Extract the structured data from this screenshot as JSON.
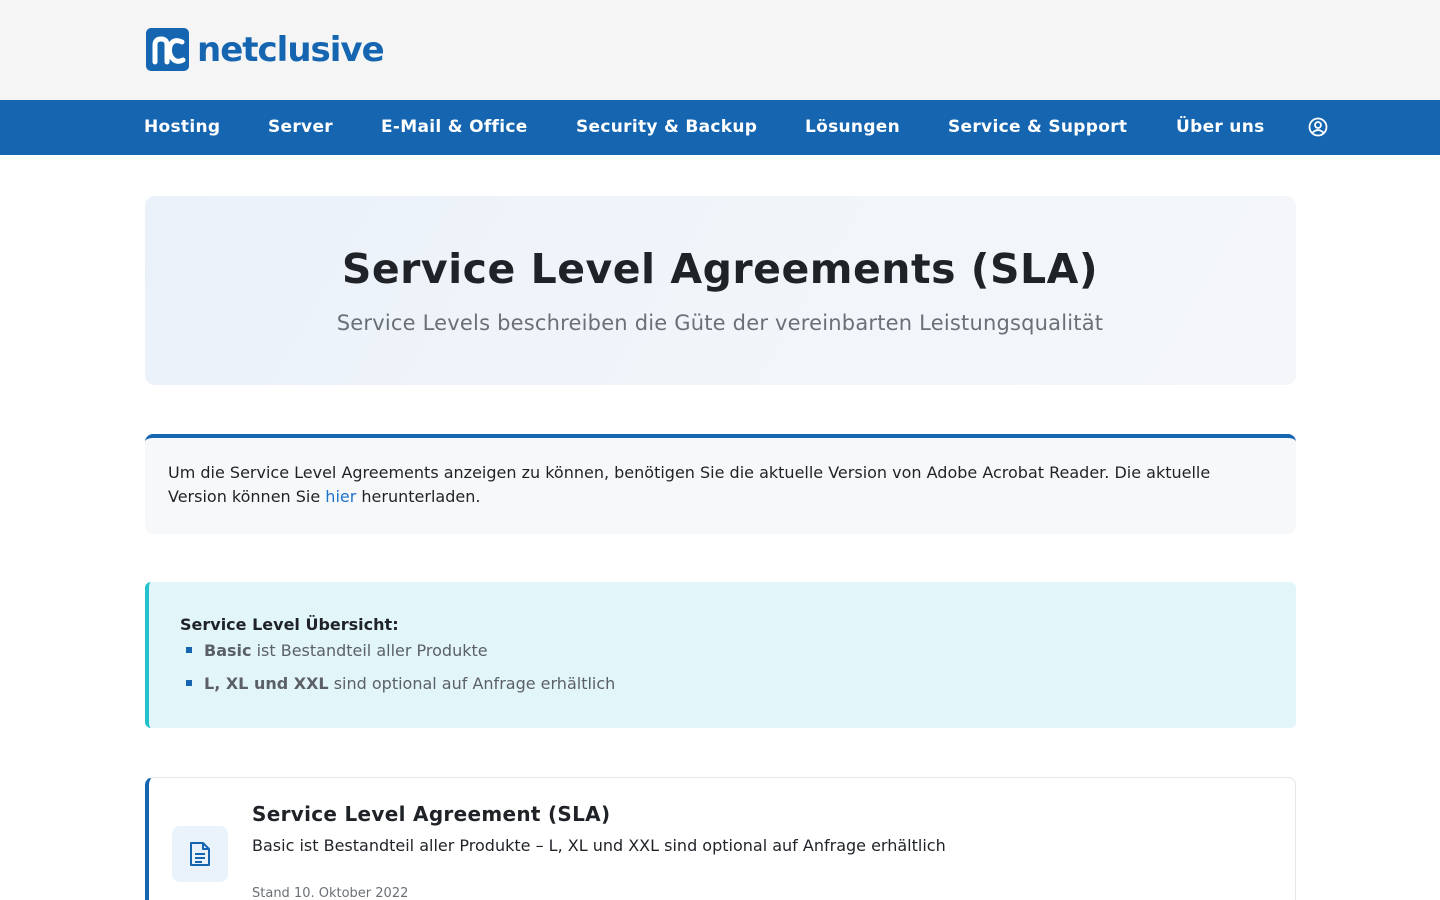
{
  "brand": {
    "name": "netclusive",
    "primary_color": "#1565b0",
    "accent_color": "#21c2cc"
  },
  "nav": {
    "items": [
      {
        "label": "Hosting"
      },
      {
        "label": "Server"
      },
      {
        "label": "E-Mail & Office"
      },
      {
        "label": "Security & Backup"
      },
      {
        "label": "Lösungen"
      },
      {
        "label": "Service & Support"
      },
      {
        "label": "Über uns"
      }
    ],
    "account_icon": "user-circle-icon"
  },
  "hero": {
    "title": "Service Level Agreements (SLA)",
    "subtitle": "Service Levels beschreiben die Güte der vereinbarten Leistungsqualität"
  },
  "note": {
    "text_before": "Um die Service Level Agreements anzeigen zu können, benötigen Sie die aktuelle Version von Adobe Acrobat Reader. Die aktuelle Version können Sie ",
    "link_label": "hier",
    "text_after": " herunterladen."
  },
  "overview": {
    "title": "Service Level Übersicht:",
    "items": [
      {
        "bold": "Basic",
        "text": " ist Bestandteil aller Produkte"
      },
      {
        "bold": "L, XL und XXL",
        "text": " sind optional auf Anfrage erhältlich"
      }
    ]
  },
  "document": {
    "icon": "document-icon",
    "title": "Service Level Agreement (SLA)",
    "description": "Basic ist Bestandteil aller Produkte – L, XL und XXL sind optional auf Anfrage erhältlich",
    "date": "Stand 10. Oktober 2022"
  }
}
